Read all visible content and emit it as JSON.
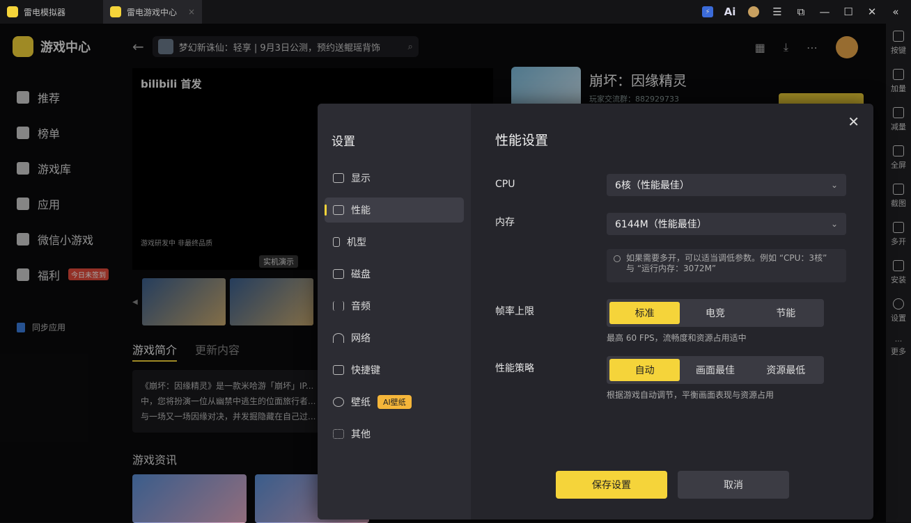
{
  "window": {
    "tabs": [
      {
        "label": "雷电模拟器"
      },
      {
        "label": "雷电游戏中心"
      }
    ],
    "controls": [
      "lightning-icon",
      "ai-icon",
      "user-icon",
      "menu-icon",
      "popout-icon",
      "minimize-icon",
      "maximize-icon",
      "close-icon",
      "collapse-icon"
    ]
  },
  "sidebar": {
    "brand": "游戏中心",
    "items": [
      {
        "label": "推荐"
      },
      {
        "label": "榜单"
      },
      {
        "label": "游戏库"
      },
      {
        "label": "应用"
      },
      {
        "label": "微信小游戏"
      },
      {
        "label": "福利",
        "badge": "今日未签到"
      }
    ],
    "sync": "同步应用"
  },
  "search": {
    "text": "梦幻新诛仙：轻享 | 9月3日公测，预约送鲲瑶背饰"
  },
  "game": {
    "title": "崩坏：因缘精灵",
    "group": "玩家交流群：882929733",
    "video_watermark": "bilibili 首发",
    "video_note": "游戏研发中 非最终品质",
    "video_demo": "实机演示",
    "tabs": [
      {
        "label": "游戏简介"
      },
      {
        "label": "更新内容"
      }
    ],
    "desc": "《崩坏：因缘精灵》是一款米哈游「崩坏」IP... 中，您将扮演一位从幽禁中逃生的位面旅行者... 与一场又一场因缘对决，并发掘隐藏在自己过...",
    "news_title": "游戏资讯"
  },
  "right_toolbar": [
    {
      "label": "按键"
    },
    {
      "label": "加量"
    },
    {
      "label": "减量"
    },
    {
      "label": "全屏"
    },
    {
      "label": "截图"
    },
    {
      "label": "多开"
    },
    {
      "label": "安装"
    },
    {
      "label": "设置"
    },
    {
      "label": "更多"
    }
  ],
  "settings": {
    "title": "设置",
    "menu": [
      {
        "label": "显示",
        "icon": "monitor-icon"
      },
      {
        "label": "性能",
        "icon": "performance-icon"
      },
      {
        "label": "机型",
        "icon": "phone-icon"
      },
      {
        "label": "磁盘",
        "icon": "disk-icon"
      },
      {
        "label": "音频",
        "icon": "audio-icon"
      },
      {
        "label": "网络",
        "icon": "wifi-icon"
      },
      {
        "label": "快捷键",
        "icon": "keyboard-icon"
      },
      {
        "label": "壁纸",
        "icon": "palette-icon",
        "badge": "AI壁纸"
      },
      {
        "label": "其他",
        "icon": "grid-icon"
      }
    ],
    "active_menu": "性能",
    "panel_title": "性能设置",
    "cpu_label": "CPU",
    "cpu_value": "6核（性能最佳）",
    "memory_label": "内存",
    "memory_value": "6144M（性能最佳）",
    "hint": "如果需要多开，可以适当调低参数。例如 “CPU：3核” 与 “运行内存：3072M”",
    "fps_label": "帧率上限",
    "fps_options": [
      {
        "label": "标准"
      },
      {
        "label": "电竞"
      },
      {
        "label": "节能"
      }
    ],
    "fps_selected": "标准",
    "fps_note": "最高 60 FPS，流畅度和资源占用适中",
    "strategy_label": "性能策略",
    "strategy_options": [
      {
        "label": "自动"
      },
      {
        "label": "画面最佳"
      },
      {
        "label": "资源最低"
      }
    ],
    "strategy_selected": "自动",
    "strategy_note": "根据游戏自动调节，平衡画面表现与资源占用",
    "save": "保存设置",
    "cancel": "取消"
  }
}
